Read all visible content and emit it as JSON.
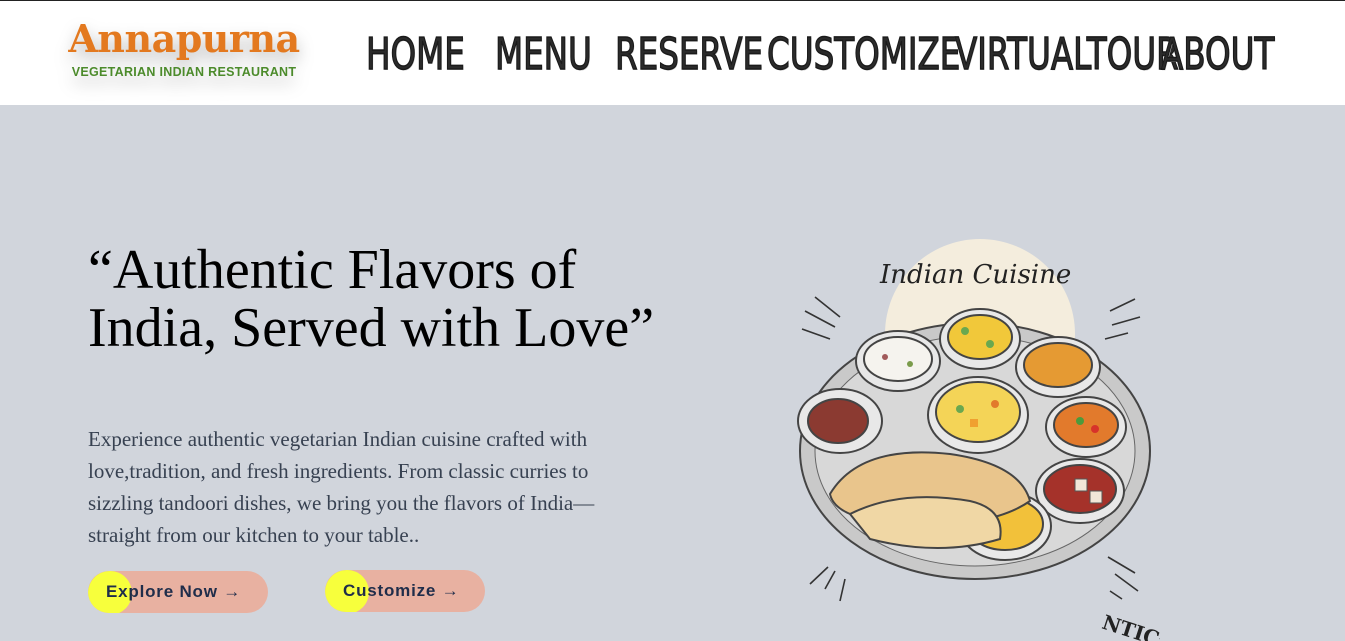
{
  "brand": {
    "name": "Annapurna",
    "tagline": "VEGETARIAN INDIAN RESTAURANT",
    "primary_color": "#e3791f",
    "secondary_color": "#4c8b2b"
  },
  "nav": {
    "items": [
      {
        "label": "HOME"
      },
      {
        "label": "MENU"
      },
      {
        "label": "RESERVE"
      },
      {
        "label": "CUSTOMIZE"
      },
      {
        "label": "VIRTUALTOUR"
      },
      {
        "label": "ABOUT"
      }
    ]
  },
  "hero": {
    "title": "“Authentic Flavors of India, Served with Love”",
    "description": "Experience authentic vegetarian Indian cuisine crafted with love,tradition, and fresh ingredients. From classic curries to sizzling tandoori dishes, we bring you the flavors of India—straight from our kitchen to your table..",
    "explore_label": "Explore Now →",
    "customize_label": "Customize →",
    "button_color": "#e8b1a1",
    "accent_color": "#f7ff3c"
  },
  "illustration": {
    "caption": "Indian Cuisine",
    "stamp_text": "NTIC* IN",
    "icon": "thali-plate-illustration"
  }
}
